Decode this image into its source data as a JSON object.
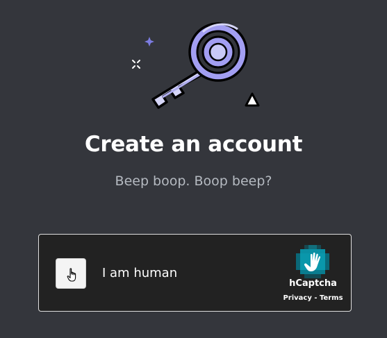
{
  "header": {
    "title": "Create an account",
    "subtitle": "Beep boop. Boop beep?"
  },
  "captcha": {
    "checkbox_label": "I am human",
    "brand": "hCaptcha",
    "privacy_link": "Privacy",
    "separator": " - ",
    "terms_link": "Terms"
  },
  "icons": {
    "illustration": "key-illustration-icon",
    "checkbox_cursor": "pointer-hand-icon",
    "brand_logo": "hcaptcha-logo-icon"
  },
  "colors": {
    "background": "#34363c",
    "key_fill": "#c9c9f7",
    "key_accent": "#a29ef2",
    "sparkle": "#7c7ce0",
    "captcha_bg": "#222222",
    "logo_teal": "#0a8fa3"
  }
}
